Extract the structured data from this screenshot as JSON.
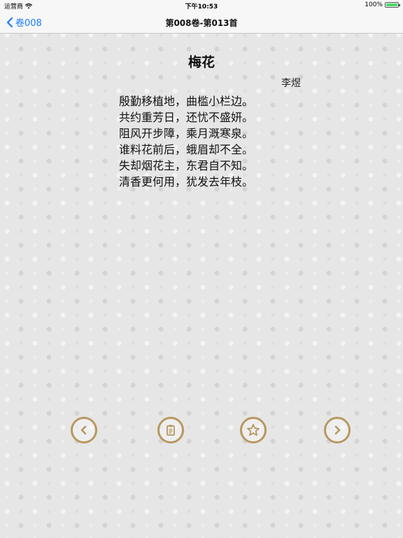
{
  "status_bar": {
    "carrier": "运营商",
    "time": "下午10:53",
    "battery": "100%",
    "battery_level": 1.0
  },
  "nav": {
    "back_label": "卷008",
    "title": "第008卷-第013首"
  },
  "poem": {
    "title": "梅花",
    "author": "李煜",
    "lines": [
      "殷勤移植地，曲槛小栏边。",
      "共约重芳日，还忧不盛妍。",
      "阻风开步障，乘月溉寒泉。",
      "谁料花前后，蛾眉却不全。",
      "失却烟花主，东君自不知。",
      "清香更何用，犹发去年枝。"
    ]
  },
  "toolbar": {
    "buttons": [
      {
        "name": "previous-button",
        "icon": "chevron-left-icon"
      },
      {
        "name": "notes-button",
        "icon": "notes-icon"
      },
      {
        "name": "favorite-button",
        "icon": "star-icon"
      },
      {
        "name": "next-button",
        "icon": "chevron-right-icon"
      }
    ]
  },
  "colors": {
    "accent": "#1a7cf7",
    "button_ring": "#b8975f",
    "background": "#e6e6e6"
  }
}
